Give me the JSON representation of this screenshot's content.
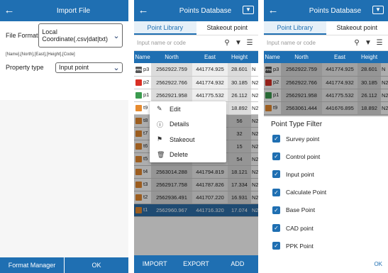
{
  "import_screen": {
    "title": "Import File",
    "file_format_label": "File Format",
    "file_format_value": "Local Coordinate(.csv|dat|txt)",
    "fields_hint": "[Name],[North],[East],[Height],[Code]",
    "property_type_label": "Property type",
    "property_type_value": "Input point",
    "format_manager_label": "Format Manager",
    "ok_label": "OK"
  },
  "points_screen": {
    "title": "Points Database",
    "tabs": [
      "Point Library",
      "Stakeout point"
    ],
    "search_placeholder": "Input name or code",
    "columns": [
      "Name",
      "North",
      "East",
      "Height"
    ],
    "rows": [
      {
        "badge": "PPK",
        "type": "ppk",
        "name": "p3",
        "north": "2562922.759",
        "east": "441774.925",
        "height": "28.601",
        "code": "N"
      },
      {
        "badge": "",
        "type": "ctrl",
        "name": "p2",
        "north": "2562922.766",
        "east": "441774.932",
        "height": "30.185",
        "code": "N2"
      },
      {
        "badge": "",
        "type": "inp",
        "name": "p1",
        "north": "2562921.958",
        "east": "441775.532",
        "height": "26.112",
        "code": "N2"
      },
      {
        "badge": "",
        "type": "surv",
        "name": "t9",
        "north": "2563061.444",
        "east": "441676.895",
        "height": "18.892",
        "code": "N2"
      },
      {
        "badge": "",
        "type": "surv",
        "name": "t8",
        "north": "",
        "east": "",
        "height": "56",
        "code": "N2"
      },
      {
        "badge": "",
        "type": "surv",
        "name": "t7",
        "north": "",
        "east": "",
        "height": "32",
        "code": "N2"
      },
      {
        "badge": "",
        "type": "surv",
        "name": "t6",
        "north": "",
        "east": "",
        "height": "15",
        "code": "N2"
      },
      {
        "badge": "",
        "type": "surv",
        "name": "t5",
        "north": "",
        "east": "",
        "height": "54",
        "code": "N2"
      },
      {
        "badge": "",
        "type": "surv",
        "name": "t4",
        "north": "2563014.288",
        "east": "441794.819",
        "height": "18.121",
        "code": "N2"
      },
      {
        "badge": "",
        "type": "surv",
        "name": "t3",
        "north": "2562917.758",
        "east": "441787.826",
        "height": "17.334",
        "code": "N2"
      },
      {
        "badge": "",
        "type": "surv",
        "name": "t2",
        "north": "2562936.491",
        "east": "441707.220",
        "height": "16.931",
        "code": "N2"
      },
      {
        "badge": "",
        "type": "surv",
        "name": "t1",
        "north": "2562960.967",
        "east": "441716.320",
        "height": "17.074",
        "code": "N2",
        "selected": true
      }
    ],
    "context_menu": [
      "Edit",
      "Details",
      "Stakeout",
      "Delete"
    ],
    "bottom_buttons": [
      "IMPORT",
      "EXPORT",
      "ADD"
    ]
  },
  "filter_sheet": {
    "title": "Point Type Filter",
    "options": [
      "Survey point",
      "Control point",
      "Input point",
      "Calculate Point",
      "Base Point",
      "CAD point",
      "PPK Point"
    ],
    "ok_label": "OK"
  },
  "colors": {
    "header": "#1f6fb2",
    "selected_row": "#2f6fa8",
    "control": "#d93025",
    "input": "#3b9b4f",
    "survey": "#e68a2e",
    "ppk": "#555555"
  }
}
